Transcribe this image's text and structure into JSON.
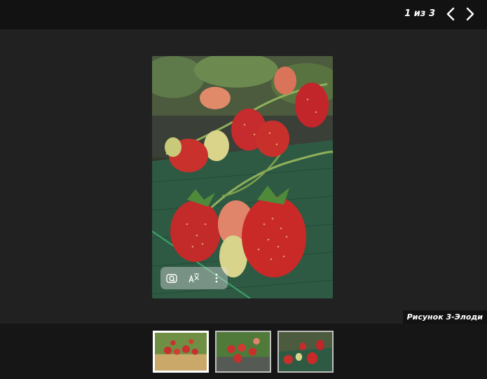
{
  "viewer": {
    "counter": "1 из 3",
    "caption": "Рисунок 3-Элоди"
  },
  "icons": {
    "prev": "chevron-left-icon",
    "next": "chevron-right-icon",
    "visual_search": "camera-search-icon",
    "translate": "translate-icon",
    "more": "more-vertical-icon"
  },
  "thumbnails": [
    {
      "selected": true
    },
    {
      "selected": false
    },
    {
      "selected": false
    }
  ]
}
